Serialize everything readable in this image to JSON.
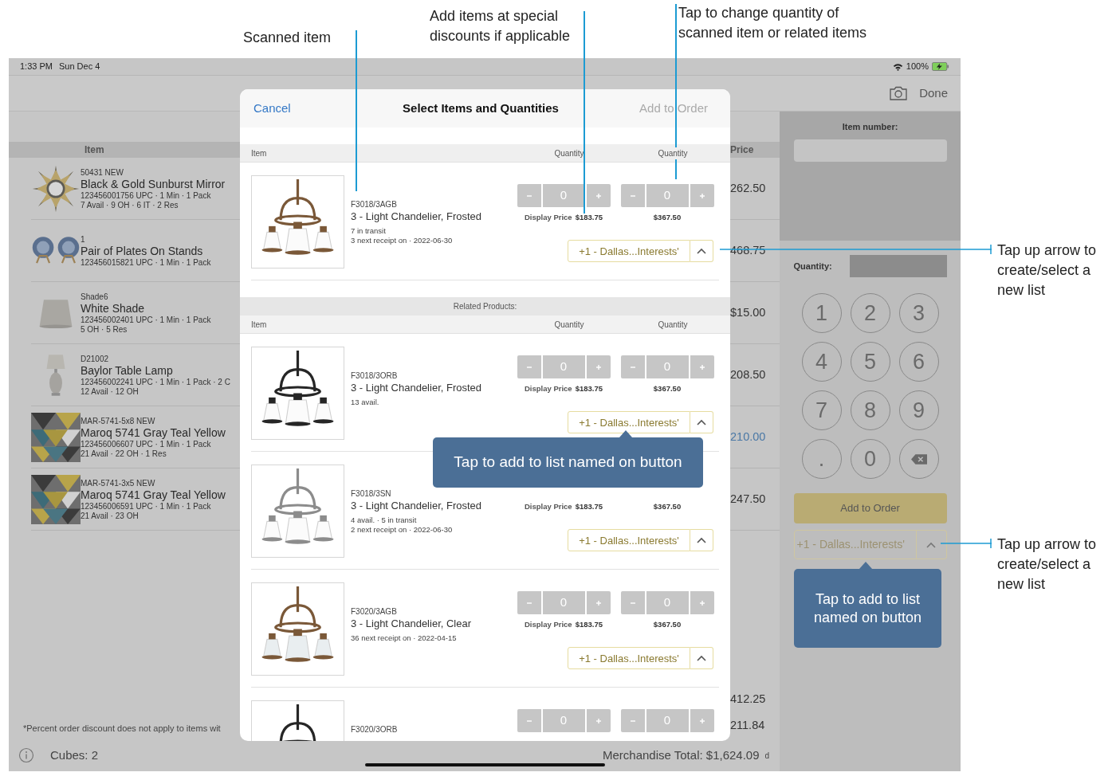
{
  "annotations": [
    {
      "lines": [
        "Scanned item"
      ]
    },
    {
      "lines": [
        "Add items at special",
        "discounts if applicable"
      ]
    },
    {
      "lines": [
        "Tap to change quantity of",
        "scanned item or related items"
      ]
    },
    {
      "lines": [
        "Tap up arrow to",
        "create/select a",
        "new list"
      ]
    },
    {
      "lines": [
        "Tap up arrow to",
        "create/select a",
        "new list"
      ]
    }
  ],
  "status_bar": {
    "time": "1:33 PM",
    "date": "Sun Dec 4",
    "battery": "100%"
  },
  "toolbar": {
    "done": "Done"
  },
  "order_table": {
    "columns": [
      "Item",
      "Price"
    ],
    "rows": [
      {
        "sku": "50431 NEW",
        "name": "Black & Gold Sunburst Mirror",
        "details": [
          "123456001756 UPC · 1 Min · 1 Pack",
          "7 Avail · 9 OH · 6 IT · 2 Res"
        ],
        "price": "262.50",
        "special_price": false
      },
      {
        "sku": "1",
        "name": "Pair of Plates On Stands",
        "details": [
          "123456015821 UPC · 1 Min · 1 Pack"
        ],
        "price": "468.75",
        "special_price": false
      },
      {
        "sku": "Shade6",
        "name": "White Shade",
        "details": [
          "123456002401 UPC · 1 Min · 1 Pack",
          "5 OH · 5 Res"
        ],
        "price": "$15.00",
        "special_price": false
      },
      {
        "sku": "D21002",
        "name": "Baylor Table Lamp",
        "details": [
          "123456002241 UPC · 1 Min · 1 Pack · 2 C",
          "12 Avail · 12 OH"
        ],
        "price": "208.50",
        "special_price": false
      },
      {
        "sku": "MAR-5741-5x8 NEW",
        "name": "Maroq 5741 Gray Teal Yellow",
        "details": [
          "123456006607 UPC · 1 Min · 1 Pack",
          "21 Avail · 22 OH · 1 Res"
        ],
        "price": "210.00",
        "special_price": true
      },
      {
        "sku": "MAR-5741-3x5 NEW",
        "name": "Maroq 5741 Gray Teal Yellow",
        "details": [
          "123456006591 UPC · 1 Min · 1 Pack",
          "21 Avail · 23 OH"
        ],
        "price": "247.50",
        "special_price": false
      }
    ],
    "subtotals": [
      "412.25",
      "211.84"
    ],
    "note": "*Percent order discount does not apply to items wit",
    "cubes": "Cubes: 2",
    "total": "Merchandise Total: $1,624.09",
    "total_suffix": "d"
  },
  "entry_panel": {
    "item_number_label": "Item number:",
    "quantity_label": "Quantity:",
    "keys": [
      {
        "kind": "digit",
        "label": "1"
      },
      {
        "kind": "digit",
        "label": "2"
      },
      {
        "kind": "digit",
        "label": "3"
      },
      {
        "kind": "digit",
        "label": "4"
      },
      {
        "kind": "digit",
        "label": "5"
      },
      {
        "kind": "digit",
        "label": "6"
      },
      {
        "kind": "digit",
        "label": "7"
      },
      {
        "kind": "digit",
        "label": "8"
      },
      {
        "kind": "digit",
        "label": "9"
      },
      {
        "kind": "digit",
        "label": "."
      },
      {
        "kind": "digit",
        "label": "0"
      },
      {
        "kind": "backspace"
      }
    ],
    "add_button": "Add to Order",
    "list_button": "+1 - Dallas...Interests'",
    "tooltip": "Tap to add to list named on button"
  },
  "dialog": {
    "cancel": "Cancel",
    "title": "Select Items and Quantities",
    "action": {
      "label": "Add to Order",
      "disabled": true
    },
    "columns": [
      "Item",
      "Quantity",
      "Quantity"
    ],
    "scanned": {
      "sku": "F3018/3AGB",
      "name": "3 - Light Chandelier, Frosted",
      "notes": [
        "7 in transit",
        "3 next receipt on · 2022-06-30"
      ],
      "quantities": [
        "0",
        "0"
      ],
      "price_label": "Display Price",
      "prices": [
        "$183.75",
        "$367.50"
      ],
      "list_button": "+1 - Dallas...Interests'"
    },
    "related_label": "Related Products:",
    "related_columns": [
      "Item",
      "Quantity",
      "Quantity"
    ],
    "related": [
      {
        "sku": "F3018/3ORB",
        "name": "3 - Light Chandelier, Frosted",
        "notes": [
          "13 avail."
        ],
        "quantities": [
          "0",
          "0"
        ],
        "price_label": "Display Price",
        "prices": [
          "$183.75",
          "$367.50"
        ],
        "list_button": "+1 - Dallas...Interests'"
      },
      {
        "sku": "F3018/3SN",
        "name": "3 - Light Chandelier, Frosted",
        "notes": [
          "4 avail. · 5 in transit",
          "2 next receipt on · 2022-06-30"
        ],
        "price_label": "Display Price",
        "prices": [
          "$183.75",
          "$367.50"
        ],
        "list_button": "+1 - Dallas...Interests'"
      },
      {
        "sku": "F3020/3AGB",
        "name": "3 - Light Chandelier, Clear",
        "notes": [
          "36 next receipt on · 2022-04-15"
        ],
        "quantities": [
          "0",
          "0"
        ],
        "price_label": "Display Price",
        "prices": [
          "$183.75",
          "$367.50"
        ],
        "list_button": "+1 - Dallas...Interests'"
      },
      {
        "sku": "F3020/3ORB",
        "quantities": [
          "0",
          "0"
        ]
      }
    ],
    "tooltip": "Tap to add to list named on button"
  }
}
